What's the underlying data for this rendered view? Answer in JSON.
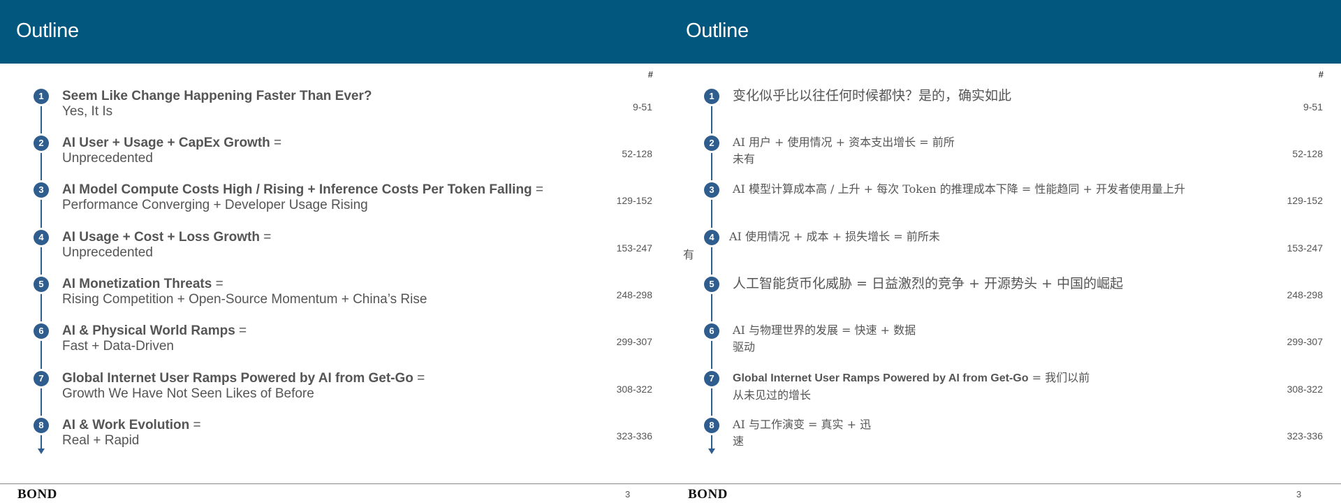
{
  "left": {
    "title": "Outline",
    "hash": "#",
    "items": [
      {
        "num": "1",
        "bold": "Seem Like Change Happening Faster Than Ever?",
        "bold_suffix": "",
        "line2": "Yes, It Is",
        "pages": "9-51"
      },
      {
        "num": "2",
        "bold": "AI User + Usage + CapEx Growth",
        "bold_suffix": " =",
        "line2": "Unprecedented",
        "pages": "52-128"
      },
      {
        "num": "3",
        "bold": "AI Model Compute Costs High / Rising + Inference Costs Per Token Falling",
        "bold_suffix": " =",
        "line2": "Performance Converging + Developer Usage Rising",
        "pages": "129-152"
      },
      {
        "num": "4",
        "bold": "AI Usage + Cost + Loss Growth",
        "bold_suffix": " =",
        "line2": "Unprecedented",
        "pages": "153-247"
      },
      {
        "num": "5",
        "bold": "AI Monetization Threats",
        "bold_suffix": " =",
        "line2": "Rising Competition + Open-Source Momentum + China’s Rise",
        "pages": "248-298"
      },
      {
        "num": "6",
        "bold": "AI & Physical World Ramps",
        "bold_suffix": " =",
        "line2": "Fast + Data-Driven",
        "pages": "299-307"
      },
      {
        "num": "7",
        "bold": "Global Internet User Ramps Powered by AI from Get-Go",
        "bold_suffix": " =",
        "line2": "Growth We Have Not Seen Likes of Before",
        "pages": "308-322"
      },
      {
        "num": "8",
        "bold": "AI & Work Evolution",
        "bold_suffix": " =",
        "line2": "Real + Rapid",
        "pages": "323-336"
      }
    ],
    "footer_brand": "BOND",
    "footer_page": "3"
  },
  "right": {
    "title": "Outline",
    "hash": "#",
    "items": [
      {
        "num": "1",
        "line1": "变化似乎比以往任何时候都快？是的，确实如此",
        "line2": "",
        "pages": "9-51"
      },
      {
        "num": "2",
        "line1": "AI 用户 + 使用情况 + 资本支出增长 = 前所",
        "line2": "未有",
        "pages": "52-128"
      },
      {
        "num": "3",
        "line1": "AI 模型计算成本高 / 上升 + 每次 Token 的推理成本下降 = 性能趋同 + 开发者使用量上升",
        "line2": "",
        "pages": "129-152"
      },
      {
        "num": "4",
        "line1": "AI 使用情况 + 成本 + 损失增长 = 前所未",
        "line2": "有",
        "pages": "153-247"
      },
      {
        "num": "5",
        "line1": "人工智能货币化威胁 = 日益激烈的竞争 + 开源势头 + 中国的崛起",
        "line2": "",
        "pages": "248-298"
      },
      {
        "num": "6",
        "line1": "AI 与物理世界的发展 = 快速 + 数据",
        "line2": "驱动",
        "pages": "299-307"
      },
      {
        "num": "7",
        "line1_en": "Global Internet User Ramps Powered by AI from Get-Go",
        "line1_zh": " = 我们以前",
        "line2": "从未见过的增长",
        "pages": "308-322"
      },
      {
        "num": "8",
        "line1": "AI 与工作演变 = 真实 + 迅",
        "line2": "速",
        "pages": "323-336"
      }
    ],
    "footer_brand": "BOND",
    "footer_page": "3"
  }
}
